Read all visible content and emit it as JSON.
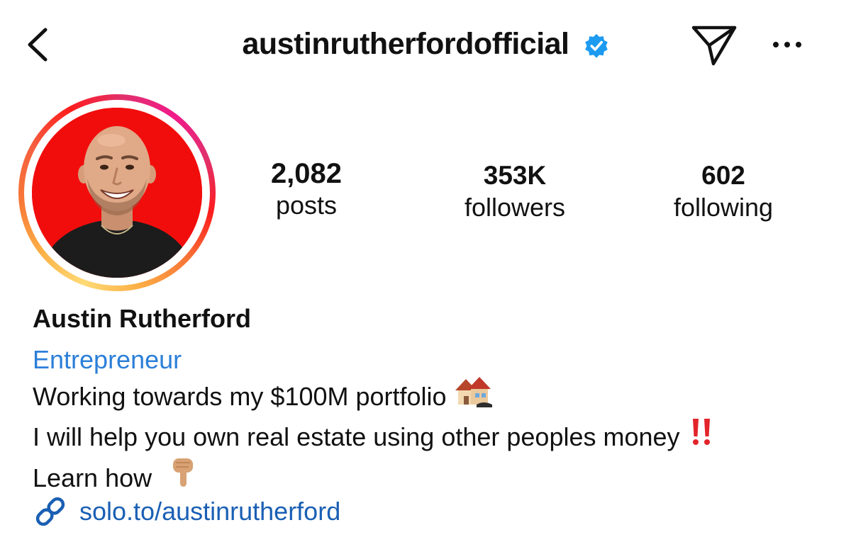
{
  "header": {
    "username": "austinrutherfordofficial",
    "back_icon": "chevron-left-icon",
    "verified_icon": "verified-badge-icon",
    "send_icon": "paper-plane-icon",
    "more_icon": "more-horizontal-icon"
  },
  "stats": {
    "posts": {
      "value": "2,082",
      "label": "posts"
    },
    "followers": {
      "value": "353K",
      "label": "followers"
    },
    "following": {
      "value": "602",
      "label": "following"
    }
  },
  "bio": {
    "full_name": "Austin Rutherford",
    "category": "Entrepreneur",
    "line1": "Working towards my $100M portfolio",
    "line1_emoji": "houses-emoji",
    "line2": "I will help you own real estate using other peoples money",
    "line2_emoji": "double-exclamation-emoji",
    "line3": "Learn how",
    "line3_emoji": "pointing-down-emoji"
  },
  "link": {
    "icon": "link-icon",
    "text": "solo.to/austinrutherford"
  },
  "colors": {
    "category": "#2b7fd8",
    "link": "#1a5fb4",
    "verified": "#1d9bf0",
    "avatar_bg": "#f20d0d"
  }
}
